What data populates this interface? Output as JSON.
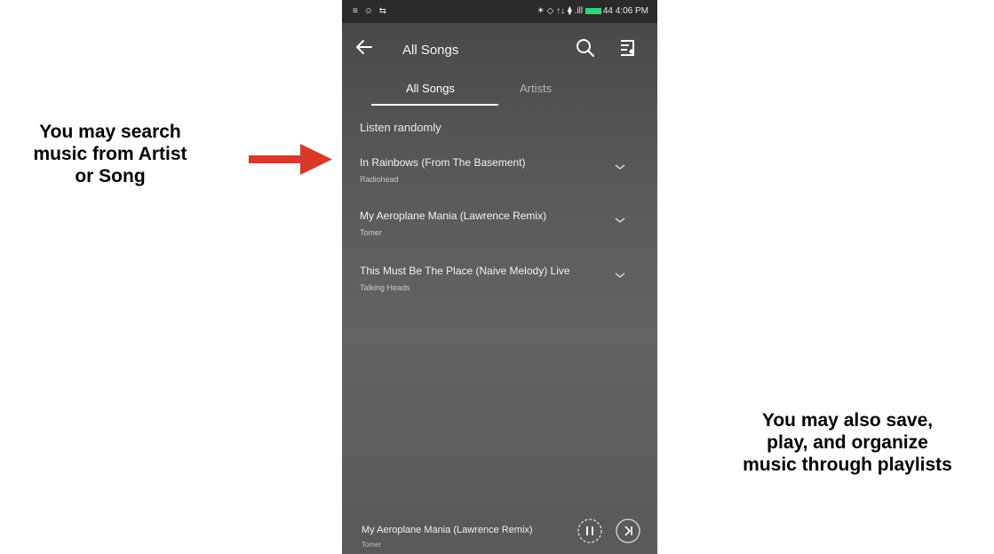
{
  "annotations": {
    "left": [
      "You may search",
      "music from Artist",
      "or Song"
    ],
    "right": [
      "You may also save,",
      "play, and organize",
      "music through playlists"
    ]
  },
  "status_bar": {
    "left": "≡ ☺ ⇆",
    "right": "✶ ◇ ↑↓ ⧫ .ill",
    "battery_time": "44 4:06 PM"
  },
  "app_bar": {
    "title": "All Songs",
    "back_icon": "back-arrow-icon",
    "search_icon": "search-icon",
    "menu_icon": "playlist-icon"
  },
  "tabs": [
    {
      "label": "All Songs",
      "active": true
    },
    {
      "label": "Artists",
      "active": false
    }
  ],
  "listen_randomly": "Listen randomly",
  "songs": [
    {
      "title": "In Rainbows (From The Basement)",
      "artist": "Radiohead"
    },
    {
      "title": "My Aeroplane Mania (Lawrence Remix)",
      "artist": "Tomer"
    },
    {
      "title": "This Must Be The Place (Naive Melody) Live",
      "artist": "Talking Heads"
    }
  ],
  "player": {
    "title": "My Aeroplane Mania (Lawrence Remix)",
    "artist": "Tomer",
    "play_pause_icon": "pause-icon",
    "next_icon": "next-icon"
  },
  "colors": {
    "arrow": "#d83a2a",
    "tab_indicator": "#ffffff",
    "battery": "#33d17a"
  }
}
